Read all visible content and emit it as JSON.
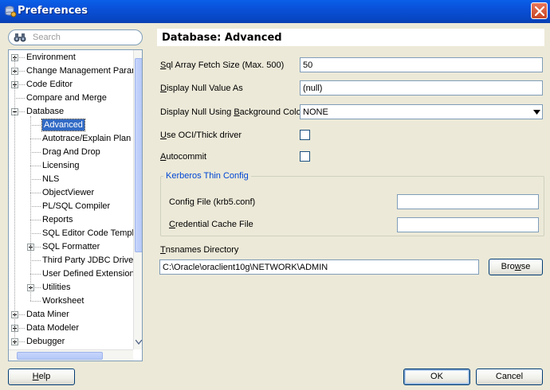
{
  "window": {
    "title": "Preferences"
  },
  "search": {
    "placeholder": "Search"
  },
  "tree": {
    "items": [
      {
        "label": "Environment",
        "level": 0,
        "expander": "plus"
      },
      {
        "label": "Change Management Param",
        "level": 0,
        "expander": "plus"
      },
      {
        "label": "Code Editor",
        "level": 0,
        "expander": "plus"
      },
      {
        "label": "Compare and Merge",
        "level": 0,
        "expander": "none"
      },
      {
        "label": "Database",
        "level": 0,
        "expander": "minus"
      },
      {
        "label": "Advanced",
        "level": 1,
        "expander": "none",
        "selected": true
      },
      {
        "label": "Autotrace/Explain Plan",
        "level": 1,
        "expander": "none"
      },
      {
        "label": "Drag And Drop",
        "level": 1,
        "expander": "none"
      },
      {
        "label": "Licensing",
        "level": 1,
        "expander": "none"
      },
      {
        "label": "NLS",
        "level": 1,
        "expander": "none"
      },
      {
        "label": "ObjectViewer",
        "level": 1,
        "expander": "none"
      },
      {
        "label": "PL/SQL Compiler",
        "level": 1,
        "expander": "none"
      },
      {
        "label": "Reports",
        "level": 1,
        "expander": "none"
      },
      {
        "label": "SQL Editor Code Templa",
        "level": 1,
        "expander": "none"
      },
      {
        "label": "SQL Formatter",
        "level": 1,
        "expander": "plus"
      },
      {
        "label": "Third Party JDBC Driver",
        "level": 1,
        "expander": "none"
      },
      {
        "label": "User Defined Extension",
        "level": 1,
        "expander": "none"
      },
      {
        "label": "Utilities",
        "level": 1,
        "expander": "plus"
      },
      {
        "label": "Worksheet",
        "level": 1,
        "expander": "none"
      },
      {
        "label": "Data Miner",
        "level": 0,
        "expander": "plus"
      },
      {
        "label": "Data Modeler",
        "level": 0,
        "expander": "plus"
      },
      {
        "label": "Debugger",
        "level": 0,
        "expander": "plus"
      }
    ]
  },
  "panel": {
    "heading": "Database: Advanced",
    "fetch_size": {
      "label_mn": "S",
      "label_rest": "ql Array Fetch Size (Max. 500)",
      "value": "50"
    },
    "null_value": {
      "label_mn": "D",
      "label_rest": "isplay Null Value As",
      "value": "(null)"
    },
    "null_bg": {
      "label_pre": "Display Null Using ",
      "label_mn": "B",
      "label_rest": "ackground Color",
      "value": "NONE"
    },
    "oci": {
      "label_mn": "U",
      "label_rest": "se OCI/Thick driver",
      "checked": false
    },
    "autocommit": {
      "label_mn": "A",
      "label_rest": "utocommit",
      "checked": false
    },
    "kerberos": {
      "title": "Kerberos Thin Config",
      "config_file": {
        "label_pre": "Confi",
        "label_mn": "g",
        "label_rest": " File (krb5.conf)",
        "value": ""
      },
      "cache_file": {
        "label_mn": "C",
        "label_rest": "redential Cache File",
        "value": ""
      }
    },
    "tnsnames": {
      "label_mn": "T",
      "label_rest": "nsnames Directory",
      "value": "C:\\Oracle\\oraclient10g\\NETWORK\\ADMIN",
      "browse_pre": "Bro",
      "browse_mn": "w",
      "browse_rest": "se"
    }
  },
  "buttons": {
    "help_mn": "H",
    "help_rest": "elp",
    "ok": "OK",
    "cancel": "Cancel"
  },
  "colors": {
    "titlebar": "#0A50D8",
    "selection": "#316AC5",
    "group_title": "#0046D5",
    "dialog_bg": "#ECE9D8"
  }
}
